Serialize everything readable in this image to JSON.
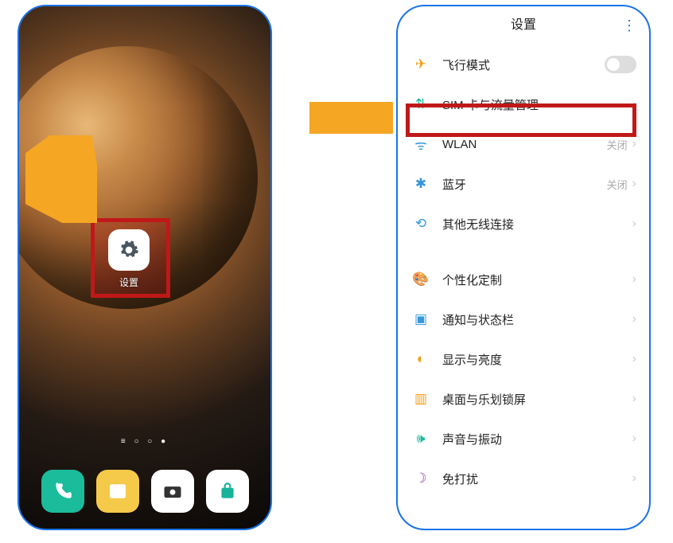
{
  "home": {
    "settings_label": "设置",
    "page_indicator": "≡ ○ ○ ●"
  },
  "arrow": {
    "alt": "→"
  },
  "settings": {
    "title": "设置",
    "groups": [
      {
        "rows": [
          {
            "icon": "✈",
            "icon_class": "c-orange",
            "label": "飞行模式",
            "type": "toggle"
          },
          {
            "icon": "⇅",
            "icon_class": "c-green",
            "label": "SIM 卡与流量管理",
            "type": "nav",
            "highlight": true
          },
          {
            "icon": "ᯤ",
            "icon_class": "c-blue",
            "label": "WLAN",
            "value": "关闭",
            "type": "nav"
          },
          {
            "icon": "✱",
            "icon_class": "c-blue",
            "label": "蓝牙",
            "value": "关闭",
            "type": "nav"
          },
          {
            "icon": "⟲",
            "icon_class": "c-blue",
            "label": "其他无线连接",
            "type": "nav"
          }
        ]
      },
      {
        "rows": [
          {
            "icon": "🎨",
            "icon_class": "c-teal",
            "label": "个性化定制",
            "type": "nav"
          },
          {
            "icon": "▣",
            "icon_class": "c-blue",
            "label": "通知与状态栏",
            "type": "nav"
          },
          {
            "icon": "◐",
            "icon_class": "c-orange",
            "label": "显示与亮度",
            "type": "nav"
          },
          {
            "icon": "▥",
            "icon_class": "c-orange",
            "label": "桌面与乐划锁屏",
            "type": "nav"
          },
          {
            "icon": "🕪",
            "icon_class": "c-green",
            "label": "声音与振动",
            "type": "nav"
          },
          {
            "icon": "☽",
            "icon_class": "c-purple",
            "label": "免打扰",
            "type": "nav"
          }
        ]
      }
    ]
  }
}
